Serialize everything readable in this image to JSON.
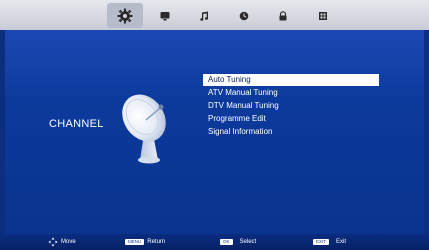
{
  "colors": {
    "background": "#0c3a9c",
    "top_bar": "#d7dae2",
    "selection": "#ffffff",
    "text": "#ffffff"
  },
  "top_tabs": [
    {
      "icon": "gear-icon",
      "active": true
    },
    {
      "icon": "tv-icon",
      "active": false
    },
    {
      "icon": "music-note-icon",
      "active": false
    },
    {
      "icon": "clock-icon",
      "active": false
    },
    {
      "icon": "lock-icon",
      "active": false
    },
    {
      "icon": "app-grid-icon",
      "active": false
    }
  ],
  "page": {
    "title": "CHANNEL",
    "image_icon": "satellite-dish-icon"
  },
  "menu": {
    "items": [
      {
        "label": "Auto Tuning",
        "selected": true
      },
      {
        "label": "ATV Manual Tuning",
        "selected": false
      },
      {
        "label": "DTV Manual Tuning",
        "selected": false
      },
      {
        "label": "Programme Edit",
        "selected": false
      },
      {
        "label": "Signal Information",
        "selected": false
      }
    ]
  },
  "hints": {
    "move": {
      "icon": "move-arrows-icon",
      "text": "Move"
    },
    "return": {
      "key": "MENU",
      "text": "Return"
    },
    "select": {
      "key": "OK",
      "text": "Select"
    },
    "exit": {
      "key": "EXIT",
      "text": "Exit"
    }
  }
}
